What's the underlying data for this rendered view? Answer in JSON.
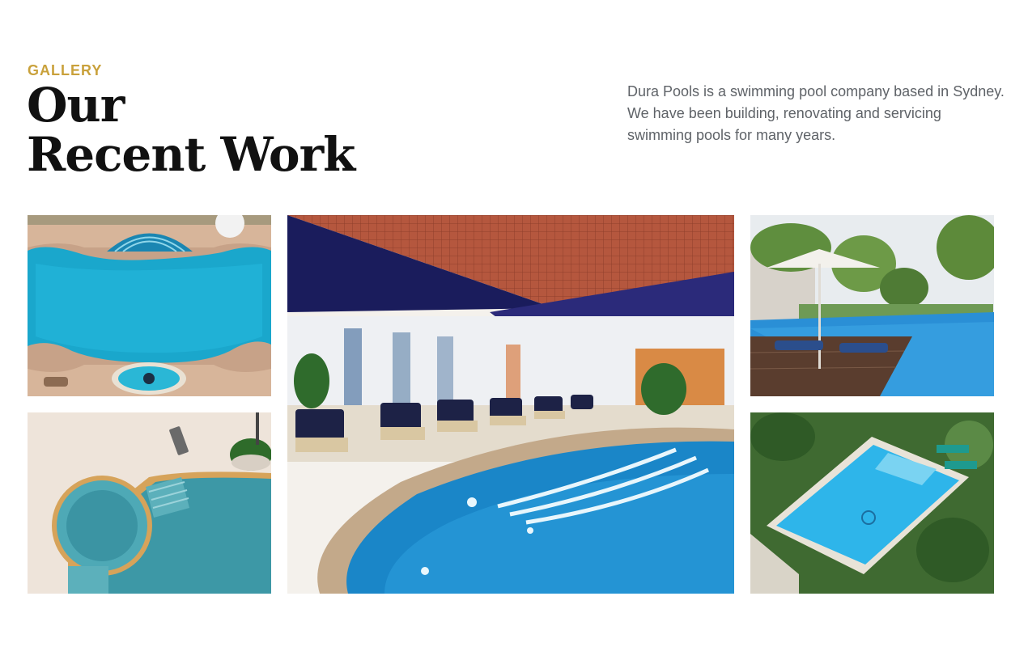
{
  "section": {
    "eyebrow": "GALLERY",
    "title_line1": "Our",
    "title_line2": "Recent Work",
    "description": "Dura Pools is a swimming pool company based in Sydney. We have been building, renovating and servicing swimming pools for many years."
  },
  "colors": {
    "accent": "#c9a13b",
    "heading": "#111111",
    "body_text": "#5f6368"
  },
  "gallery": {
    "items": [
      {
        "subject": "aerial view of curved pool with spa"
      },
      {
        "subject": "aerial view of pool with round wading pool and steps"
      },
      {
        "subject": "indoor pool with loungers"
      },
      {
        "subject": "resort pool with umbrella and sun loungers among palms"
      },
      {
        "subject": "aerial view of rectangular pool in tropical garden"
      }
    ]
  }
}
